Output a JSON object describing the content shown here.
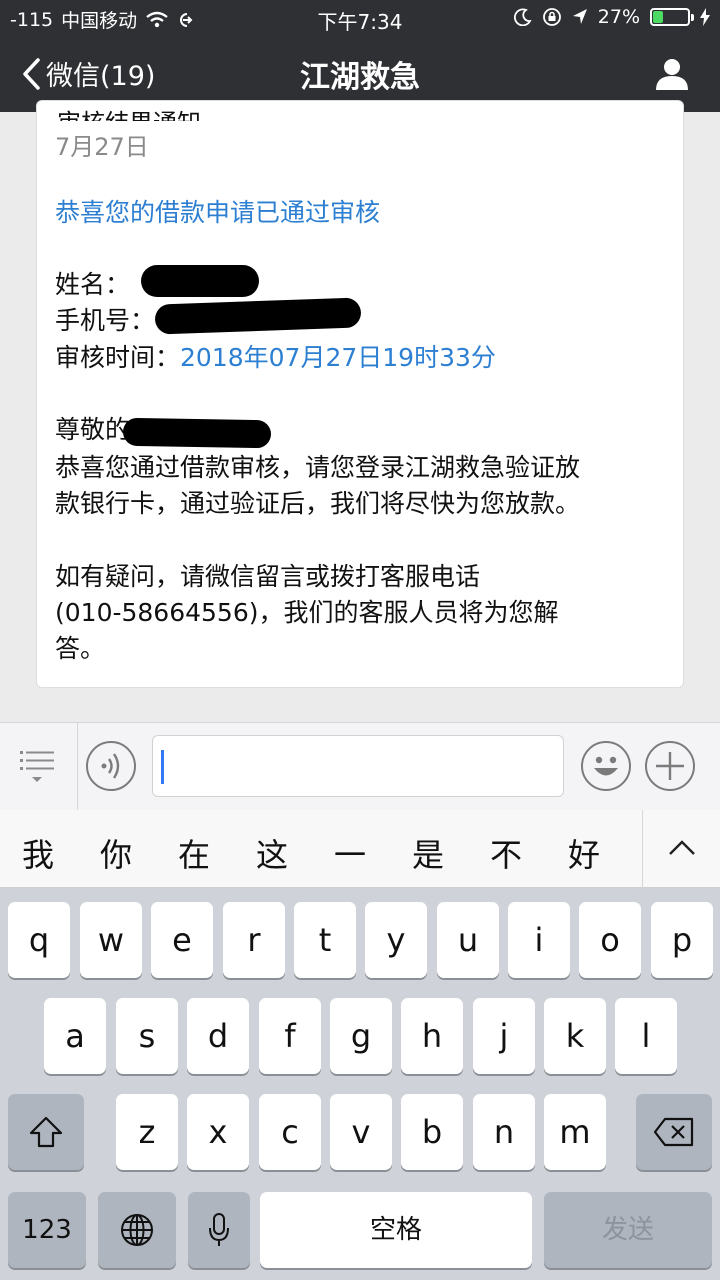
{
  "status_bar": {
    "signal": "-115",
    "carrier": "中国移动",
    "time": "下午7:34",
    "battery_percent": "27%",
    "battery_level": 0.27
  },
  "nav": {
    "back_label": "微信(19)",
    "title": "江湖救急",
    "back_icon": "chevron-left-icon",
    "profile_icon": "person-icon"
  },
  "message": {
    "header_partial": "审核结果通知",
    "date": "7月27日",
    "congrats": "恭喜您的借款申请已通过审核",
    "name_label": "姓名：",
    "phone_label": "手机号：",
    "review_time_label": "审核时间：",
    "review_time_value": "2018年07月27日19时33分",
    "greeting_prefix": "尊敬的",
    "body_line1": "恭喜您通过借款审核，请您登录江湖救急验证放",
    "body_line2": "款银行卡，通过验证后，我们将尽快为您放款。",
    "contact_line1": "如有疑问，请微信留言或拨打客服电话",
    "contact_line2": "(010-58664556)，我们的客服人员将为您解",
    "contact_line3": "答。"
  },
  "input_bar": {
    "menu_icon": "menu-list-icon",
    "voice_icon": "voice-icon",
    "emoji_icon": "emoji-icon",
    "plus_icon": "plus-icon"
  },
  "candidates": [
    "我",
    "你",
    "在",
    "这",
    "一",
    "是",
    "不",
    "好"
  ],
  "keyboard": {
    "row1": [
      "q",
      "w",
      "e",
      "r",
      "t",
      "y",
      "u",
      "i",
      "o",
      "p"
    ],
    "row2": [
      "a",
      "s",
      "d",
      "f",
      "g",
      "h",
      "j",
      "k",
      "l"
    ],
    "row3": [
      "z",
      "x",
      "c",
      "v",
      "b",
      "n",
      "m"
    ],
    "numbers_key": "123",
    "space_key": "空格",
    "send_key": "发送"
  },
  "colors": {
    "nav_bg": "#2e3034",
    "link_blue": "#2d7fd2",
    "battery_green": "#4cd964"
  }
}
